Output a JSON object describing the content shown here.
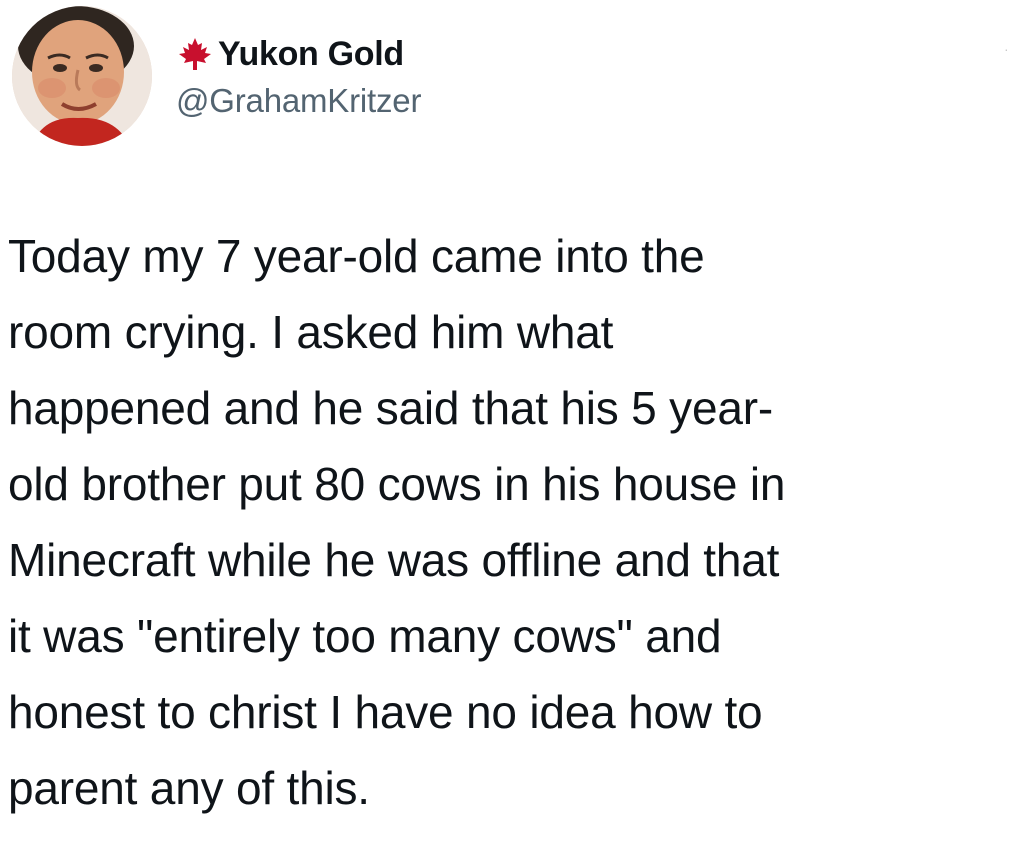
{
  "tweet": {
    "author": {
      "display_name": "Yukon Gold",
      "handle": "@GrahamKritzer",
      "name_icon": "maple-leaf-icon",
      "avatar": "profile-photo"
    },
    "more_icon": "more-options-icon",
    "text_lines": [
      "Today my 7 year-old came into the",
      "room crying. I asked him what",
      "happened and he said that his 5 year-",
      "old brother put 80 cows in his house in",
      "Minecraft while he was offline and that",
      "it was \"entirely too many cows\" and",
      "honest to christ I have no idea how to",
      "parent any of this."
    ]
  },
  "colors": {
    "text": "#0f1419",
    "secondary": "#536471",
    "leaf": "#c8102e"
  }
}
